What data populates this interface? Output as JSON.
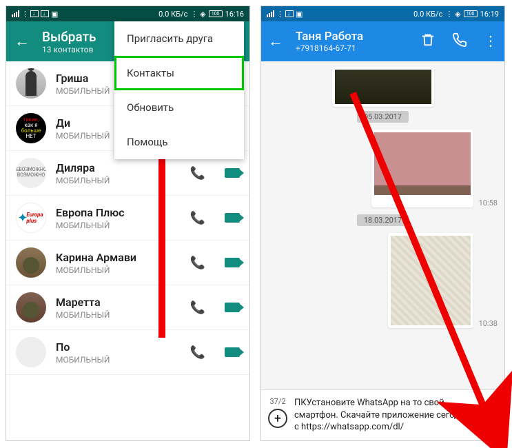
{
  "left": {
    "status": {
      "speed": "0.0 КБ/с",
      "battery": "100",
      "time": "16:16"
    },
    "header": {
      "title": "Выбрать",
      "sub": "13 контактов"
    },
    "menu": {
      "items": [
        "Пригласить друга",
        "Контакты",
        "Обновить",
        "Помощь"
      ]
    },
    "contacts": [
      {
        "name": "Гриша",
        "type": "МОБИЛЬНЫЙ"
      },
      {
        "name": "Ди",
        "type": "МОБИЛЬНЫЙ"
      },
      {
        "name": "Диляра",
        "type": "МОБИЛЬНЫЙ"
      },
      {
        "name": "Европа Плюс",
        "type": "МОБИЛЬНЫЙ"
      },
      {
        "name": "Карина Армави",
        "type": "МОБИЛЬНЫЙ"
      },
      {
        "name": "Маретта",
        "type": "МОБИЛЬНЫЙ"
      },
      {
        "name": "По",
        "type": "МОБИЛЬНЫЙ"
      }
    ]
  },
  "right": {
    "status": {
      "speed": "0.0 КБ/с",
      "battery": "100",
      "time": "16:19"
    },
    "header": {
      "name": "Таня Работа",
      "phone": "+7918164-67-71"
    },
    "dates": [
      "05.03.2017",
      "18.03.2017"
    ],
    "times": [
      "10:58",
      "10:38"
    ],
    "compose": {
      "counter": "37/2",
      "text": "ПКУстановите WhatsApp на то свой смартфон. Скачайте приложение сегодня с https://whatsapp.com/dl/"
    }
  }
}
